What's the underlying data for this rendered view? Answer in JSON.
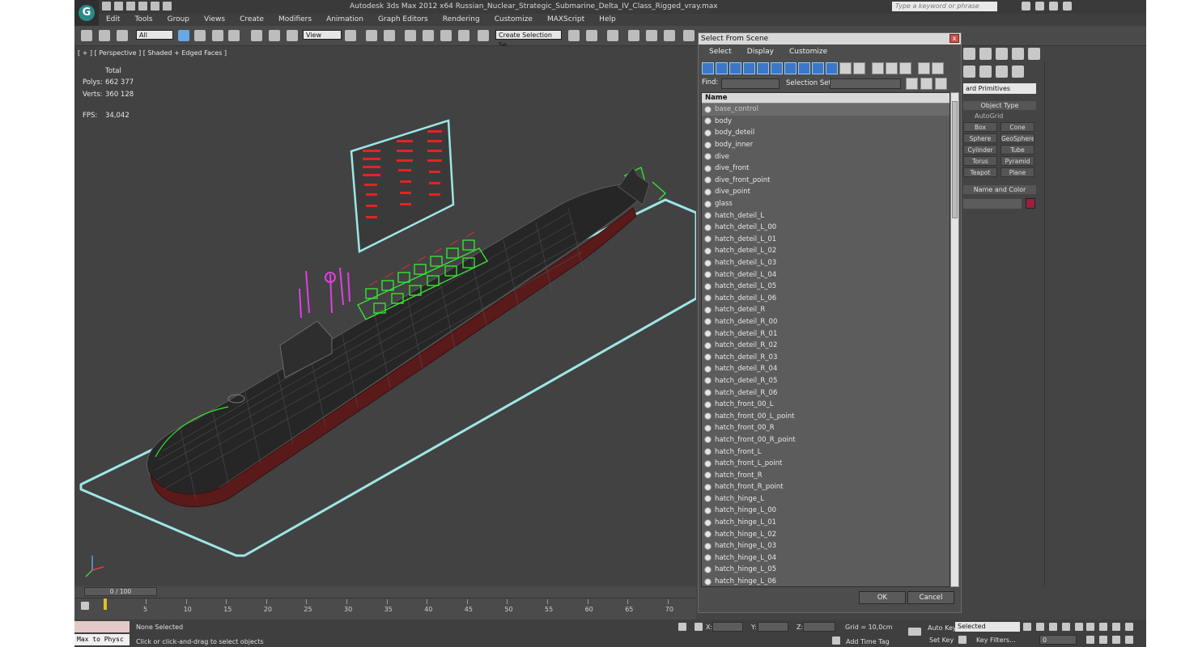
{
  "window": {
    "title": "Autodesk 3ds Max  2012 x64     Russian_Nuclear_Strategic_Submarine_Delta_IV_Class_Rigged_vray.max",
    "search_placeholder": "Type a keyword or phrase"
  },
  "menu": [
    "Edit",
    "Tools",
    "Group",
    "Views",
    "Create",
    "Modifiers",
    "Animation",
    "Graph Editors",
    "Rendering",
    "Customize",
    "MAXScript",
    "Help"
  ],
  "toolbar": {
    "filter_value": "All",
    "ref_coord_value": "View",
    "selection_set_value": "Create Selection Se"
  },
  "viewport": {
    "label": "[ + ] [ Perspective ] [ Shaded + Edged Faces ]",
    "stats": {
      "total_label": "Total",
      "polys_label": "Polys:",
      "polys_value": "662 377",
      "verts_label": "Verts:",
      "verts_value": "360 128",
      "fps_label": "FPS:",
      "fps_value": "34,042"
    }
  },
  "dialog": {
    "title": "Select From Scene",
    "close": "x",
    "menu": [
      "Select",
      "Display",
      "Customize"
    ],
    "find_label": "Find:",
    "selection_set_label": "Selection Set:",
    "column_name": "Name",
    "items": [
      "base_control",
      "body",
      "body_deteil",
      "body_inner",
      "dive",
      "dive_front",
      "dive_front_point",
      "dive_point",
      "glass",
      "hatch_deteil_L",
      "hatch_deteil_L_00",
      "hatch_deteil_L_01",
      "hatch_deteil_L_02",
      "hatch_deteil_L_03",
      "hatch_deteil_L_04",
      "hatch_deteil_L_05",
      "hatch_deteil_L_06",
      "hatch_deteil_R",
      "hatch_deteil_R_00",
      "hatch_deteil_R_01",
      "hatch_deteil_R_02",
      "hatch_deteil_R_03",
      "hatch_deteil_R_04",
      "hatch_deteil_R_05",
      "hatch_deteil_R_06",
      "hatch_front_00_L",
      "hatch_front_00_L_point",
      "hatch_front_00_R",
      "hatch_front_00_R_point",
      "hatch_front_L",
      "hatch_front_L_point",
      "hatch_front_R",
      "hatch_front_R_point",
      "hatch_hinge_L",
      "hatch_hinge_L_00",
      "hatch_hinge_L_01",
      "hatch_hinge_L_02",
      "hatch_hinge_L_03",
      "hatch_hinge_L_04",
      "hatch_hinge_L_05",
      "hatch_hinge_L_06"
    ],
    "ok_label": "OK",
    "cancel_label": "Cancel"
  },
  "command_panel": {
    "category_value": "ard Primitives",
    "object_type_header": "Object Type",
    "autogrid_label": "AutoGrid",
    "buttons": [
      "Box",
      "Cone",
      "Sphere",
      "GeoSphere",
      "Cylinder",
      "Tube",
      "Torus",
      "Pyramid",
      "Teapot",
      "Plane"
    ],
    "name_color_header": "Name and Color",
    "object_color": "#9b1f3f"
  },
  "timeline": {
    "frame_counter": "0 / 100",
    "ticks": [
      "5",
      "10",
      "15",
      "20",
      "25",
      "30",
      "35",
      "40",
      "45",
      "50",
      "55",
      "60",
      "65",
      "70"
    ]
  },
  "status": {
    "maxscript_box": "Max to Physc",
    "selection_text": "None Selected",
    "prompt_text": "Click or click-and-drag to select objects",
    "x_label": "X:",
    "y_label": "Y:",
    "z_label": "Z:",
    "grid_text": "Grid = 10,0cm",
    "add_time_tag": "Add Time Tag",
    "auto_key": "Auto Key",
    "auto_key_value": "Selected",
    "set_key": "Set Key",
    "key_filters": "Key Filters...",
    "frame_value": "0"
  }
}
